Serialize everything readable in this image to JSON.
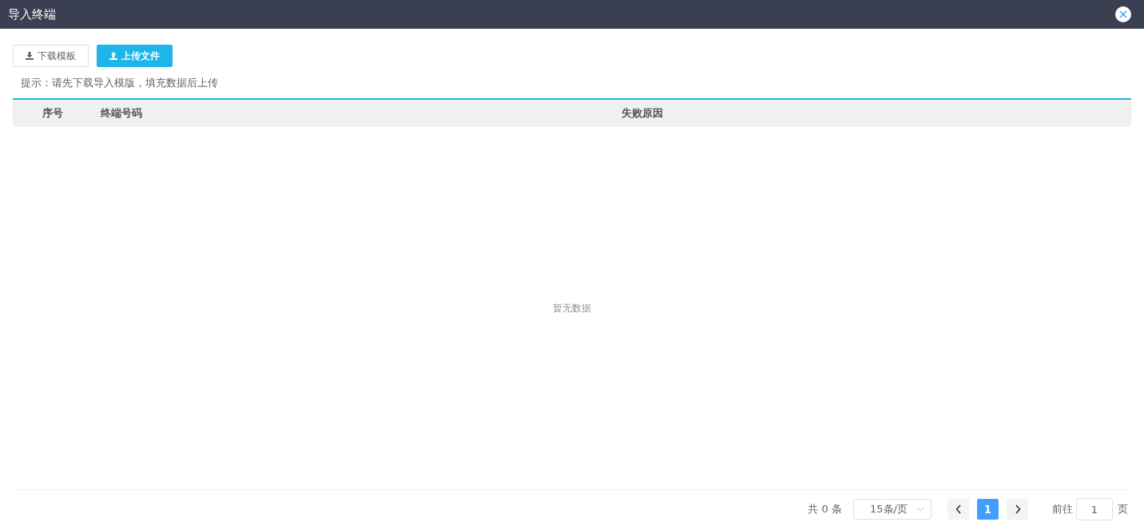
{
  "window": {
    "title": "导入终端"
  },
  "toolbar": {
    "buttons": [
      {
        "label": "下载模板",
        "kind": "download"
      },
      {
        "label": "上传文件",
        "kind": "upload"
      }
    ]
  },
  "hint": "提示：请先下载导入模版，填充数据后上传",
  "table": {
    "columns": [
      {
        "label": "序号"
      },
      {
        "label": "终端号码"
      },
      {
        "label": "失败原因"
      }
    ],
    "empty_text": "暂无数据"
  },
  "pagination": {
    "total": "共 0 条",
    "page_size": "15条/页",
    "pages": [
      {
        "label": "1",
        "selected": true
      }
    ],
    "goto_label": "前往",
    "goto_value": "1",
    "goto_suffix": "页"
  }
}
